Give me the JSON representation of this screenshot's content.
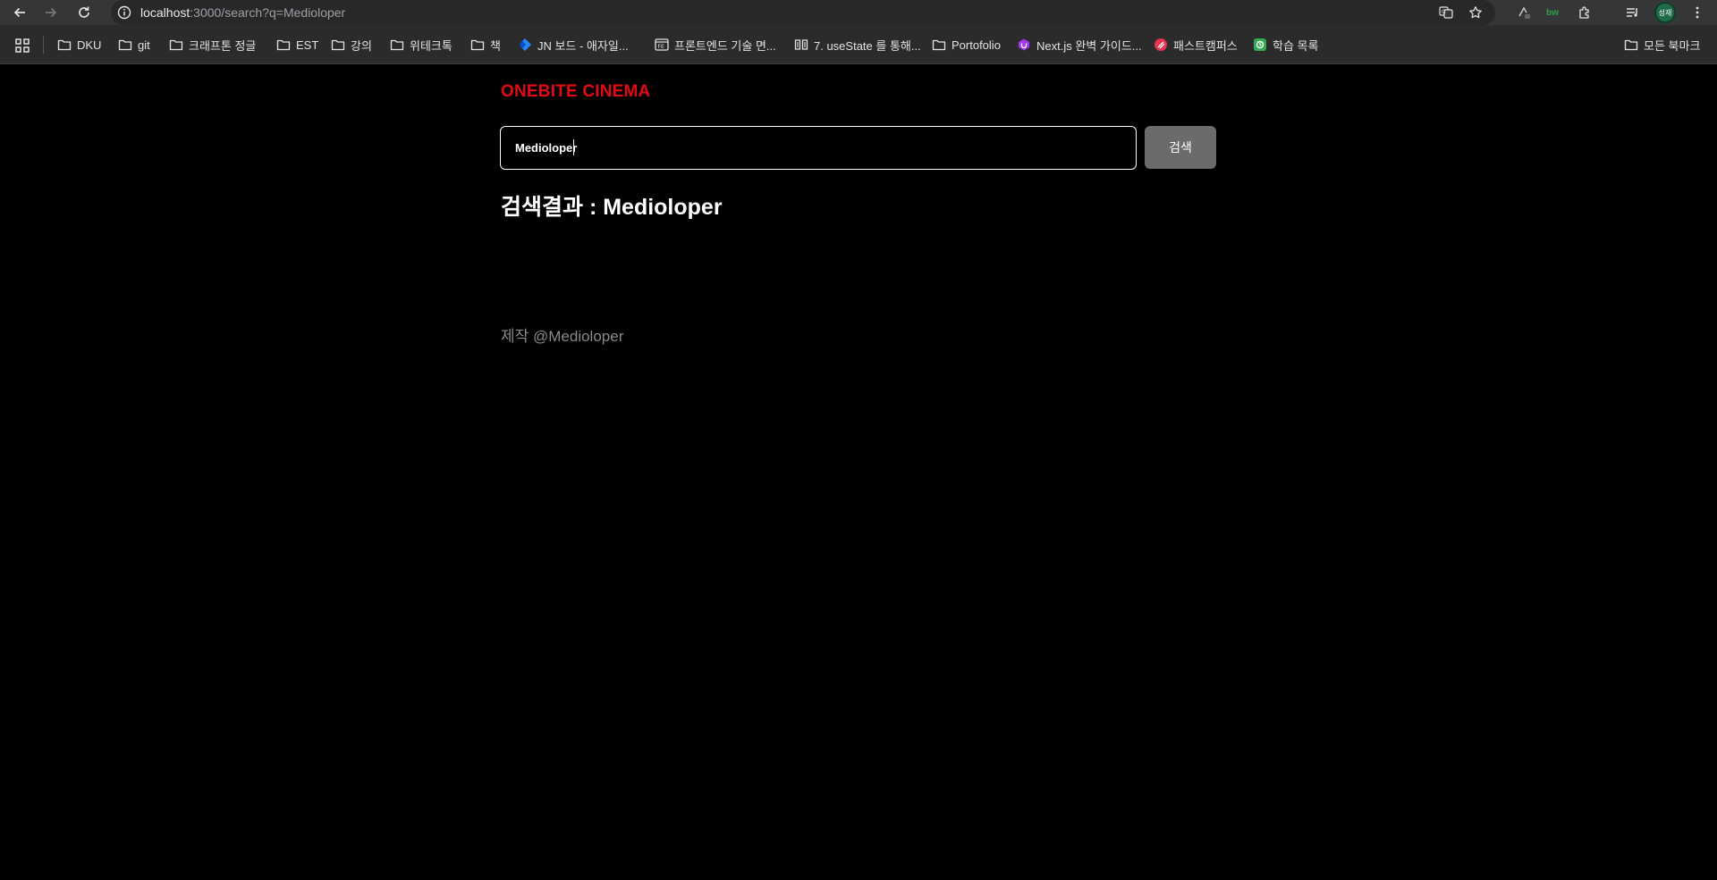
{
  "browser": {
    "url_host": "localhost",
    "url_path": ":3000/search?q=Medioloper",
    "extension_label": "bw",
    "profile_label": "성재"
  },
  "bookmarks": [
    {
      "label": "DKU",
      "type": "folder"
    },
    {
      "label": "git",
      "type": "folder"
    },
    {
      "label": "크래프톤 정글",
      "type": "folder"
    },
    {
      "label": "EST",
      "type": "folder"
    },
    {
      "label": "강의",
      "type": "folder"
    },
    {
      "label": "위테크톡",
      "type": "folder"
    },
    {
      "label": "책",
      "type": "folder"
    },
    {
      "label": "JN 보드 - 애자일...",
      "type": "jira",
      "color": "#2684ff"
    },
    {
      "label": "프론트엔드 기술 면...",
      "type": "site",
      "color": "#e3e3e3"
    },
    {
      "label": "7. useState 를 통해...",
      "type": "site",
      "color": "#e3e3e3"
    },
    {
      "label": "Portofolio",
      "type": "folder"
    },
    {
      "label": "Next.js 완벽 가이드...",
      "type": "site",
      "color": "#a435f0"
    },
    {
      "label": "패스트캠퍼스",
      "type": "site",
      "color": "#e8344e"
    },
    {
      "label": "학습 목록",
      "type": "site",
      "color": "#34a853"
    }
  ],
  "all_bookmarks": "모든 북마크",
  "app": {
    "logo": "ONEBITE CINEMA",
    "search": {
      "value": "Medioloper",
      "button_label": "검색"
    },
    "result_title": "검색결과 : Medioloper",
    "footer": "제작 @Medioloper"
  },
  "colors": {
    "brand": "#e50914",
    "background": "#000000",
    "button": "#6b6b6b"
  }
}
